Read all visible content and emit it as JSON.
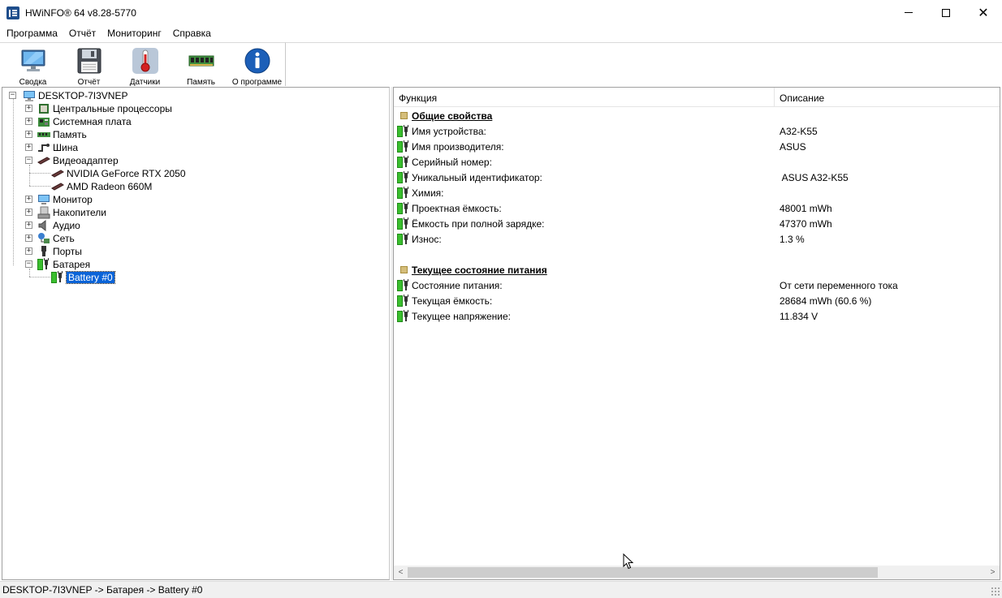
{
  "window": {
    "title": "HWiNFO® 64 v8.28-5770",
    "minimize": "—",
    "maximize": "☐",
    "close": "✕"
  },
  "menu": [
    "Программа",
    "Отчёт",
    "Мониторинг",
    "Справка"
  ],
  "toolbar": [
    {
      "label": "Сводка",
      "icon": "monitor-icon"
    },
    {
      "label": "Отчёт",
      "icon": "floppy-disk-icon"
    },
    {
      "label": "Датчики",
      "icon": "thermometer-icon"
    },
    {
      "label": "Память",
      "icon": "memory-module-icon"
    },
    {
      "label": "О программе",
      "icon": "info-icon"
    }
  ],
  "tree": {
    "root": "DESKTOP-7I3VNEP",
    "items": [
      {
        "label": "Центральные процессоры",
        "icon": "cpu-icon",
        "expander": "+"
      },
      {
        "label": "Системная плата",
        "icon": "motherboard-icon",
        "expander": "+"
      },
      {
        "label": "Память",
        "icon": "memory-icon",
        "expander": "+"
      },
      {
        "label": "Шина",
        "icon": "bus-icon",
        "expander": "+"
      },
      {
        "label": "Видеоадаптер",
        "icon": "gpu-icon",
        "expander": "−"
      },
      {
        "label": "NVIDIA GeForce RTX 2050",
        "icon": "gpu-card-icon"
      },
      {
        "label": "AMD Radeon 660M",
        "icon": "gpu-card-icon"
      },
      {
        "label": "Монитор",
        "icon": "monitor-icon",
        "expander": "+"
      },
      {
        "label": "Накопители",
        "icon": "drive-icon",
        "expander": "+"
      },
      {
        "label": "Аудио",
        "icon": "speaker-icon",
        "expander": "+"
      },
      {
        "label": "Сеть",
        "icon": "network-icon",
        "expander": "+"
      },
      {
        "label": "Порты",
        "icon": "port-icon",
        "expander": "+"
      },
      {
        "label": "Батарея",
        "icon": "battery-icon",
        "expander": "−"
      },
      {
        "label": "Battery #0",
        "icon": "battery-icon"
      }
    ]
  },
  "details": {
    "columns": [
      "Функция",
      "Описание"
    ],
    "sections": [
      {
        "title": "Общие свойства",
        "rows": [
          {
            "name": "Имя устройства:",
            "value": "A32-K55"
          },
          {
            "name": "Имя производителя:",
            "value": "ASUS"
          },
          {
            "name": "Серийный номер:",
            "value": ""
          },
          {
            "name": "Уникальный идентификатор:",
            "value": " ASUS A32-K55"
          },
          {
            "name": "Химия:",
            "value": ""
          },
          {
            "name": "Проектная ёмкость:",
            "value": "48001 mWh"
          },
          {
            "name": "Ёмкость при полной зарядке:",
            "value": "47370 mWh"
          },
          {
            "name": "Износ:",
            "value": "1.3 %"
          }
        ]
      },
      {
        "title": "Текущее состояние питания",
        "rows": [
          {
            "name": "Состояние питания:",
            "value": "От сети переменного тока"
          },
          {
            "name": "Текущая ёмкость:",
            "value": "28684 mWh (60.6 %)"
          },
          {
            "name": "Текущее напряжение:",
            "value": "11.834 V"
          }
        ]
      }
    ]
  },
  "scrollbar": {
    "left": "<",
    "right": ">"
  },
  "status": "DESKTOP-7I3VNEP -> Батарея -> Battery #0"
}
